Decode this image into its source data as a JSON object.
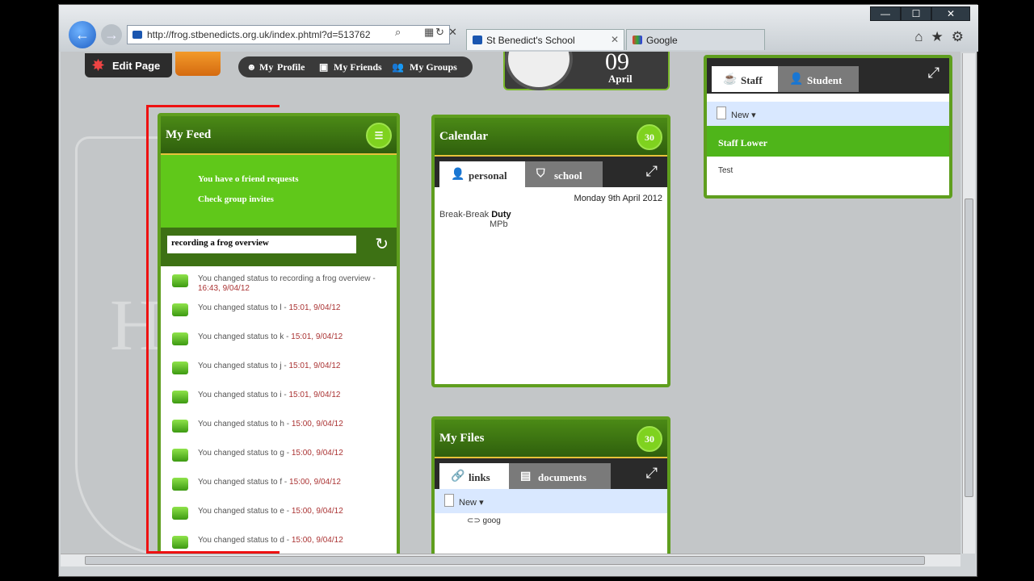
{
  "browser": {
    "url_host": "http://frog.stbenedicts.org.uk",
    "url_rest": "/index.phtml?d=513762",
    "tabs": [
      {
        "label": "St Benedict's School"
      },
      {
        "label": "Google"
      }
    ]
  },
  "toolbar": {
    "edit_label": "Edit Page"
  },
  "menu": {
    "my": "My",
    "profile": "Profile",
    "friends": "My Friends",
    "groups": "My Groups"
  },
  "date": {
    "day": "09",
    "month": "April"
  },
  "feed": {
    "title": "My Feed",
    "notice1": "You have o friend requests",
    "notice2": "Check group invites",
    "status_value": "recording a frog overview",
    "items": [
      {
        "text": "You changed status to recording a frog overview -",
        "time": "16:43, 9/04/12"
      },
      {
        "text": "You changed status to l -",
        "time": "15:01, 9/04/12"
      },
      {
        "text": "You changed status to k -",
        "time": "15:01, 9/04/12"
      },
      {
        "text": "You changed status to j -",
        "time": "15:01, 9/04/12"
      },
      {
        "text": "You changed status to i -",
        "time": "15:01, 9/04/12"
      },
      {
        "text": "You changed status to h -",
        "time": "15:00, 9/04/12"
      },
      {
        "text": "You changed status to g -",
        "time": "15:00, 9/04/12"
      },
      {
        "text": "You changed status to f -",
        "time": "15:00, 9/04/12"
      },
      {
        "text": "You changed status to e -",
        "time": "15:00, 9/04/12"
      },
      {
        "text": "You changed status to d -",
        "time": "15:00, 9/04/12"
      }
    ]
  },
  "calendar": {
    "title": "Calendar",
    "badge": "30",
    "tab_personal": "personal",
    "tab_school": "school",
    "date_label": "Monday 9th April 2012",
    "event_time": "Break-Break",
    "event_name": "Duty",
    "event_who": "MPb"
  },
  "files": {
    "title": "My Files",
    "badge": "30",
    "tab_links": "links",
    "tab_documents": "documents",
    "new_label": "New",
    "link_item": "goog"
  },
  "staff": {
    "tab_staff": "Staff",
    "tab_student": "Student",
    "new_label": "New",
    "group_title": "Staff Lower",
    "item": "Test"
  }
}
